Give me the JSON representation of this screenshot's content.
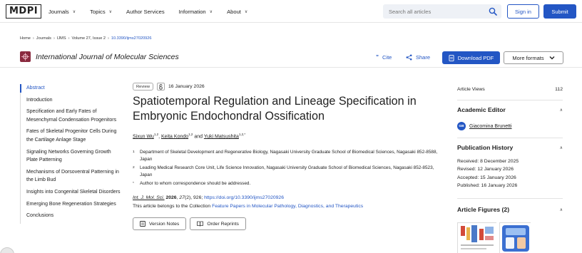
{
  "topnav": {
    "logo": "MDPI",
    "links": [
      {
        "label": "Journals",
        "dropdown": true
      },
      {
        "label": "Topics",
        "dropdown": true
      },
      {
        "label": "Author Services",
        "dropdown": false
      },
      {
        "label": "Information",
        "dropdown": true
      },
      {
        "label": "About",
        "dropdown": true
      }
    ],
    "search_placeholder": "Search all articles",
    "signin_label": "Sign in",
    "submit_label": "Submit"
  },
  "breadcrumb": {
    "items": [
      "Home",
      "Journals",
      "IJMS",
      "Volume 27, Issue 2"
    ],
    "doi": "10.3390/ijms27020926"
  },
  "journal_bar": {
    "title": "International Journal of Molecular Sciences",
    "cite_label": "Cite",
    "share_label": "Share",
    "download_label": "Download PDF",
    "more_formats_label": "More formats"
  },
  "toc": {
    "items": [
      {
        "label": "Abstract",
        "active": true
      },
      {
        "label": "Introduction",
        "active": false
      },
      {
        "label": "Specification and Early Fates of Mesenchymal Condensation Progenitors",
        "active": false
      },
      {
        "label": "Fates of Skeletal Progenitor Cells During the Cartilage Anlage Stage",
        "active": false
      },
      {
        "label": "Signaling Networks Governing Growth Plate Patterning",
        "active": false
      },
      {
        "label": "Mechanisms of Dorsoventral Patterning in the Limb Bud",
        "active": false
      },
      {
        "label": "Insights into Congenital Skeletal Disorders",
        "active": false
      },
      {
        "label": "Emerging Bone Regeneration Strategies",
        "active": false
      },
      {
        "label": "Conclusions",
        "active": false
      }
    ]
  },
  "article": {
    "type_badge": "Review",
    "date": "16 January 2026",
    "title": "Spatiotemporal Regulation and Lineage Specification in Embryonic Endochondral Ossification",
    "authors": [
      {
        "name": "Sixun Wu",
        "sup": "1,2"
      },
      {
        "name": "Keita Kondo",
        "sup": "1,2"
      },
      {
        "name": "Yuki Matsushita",
        "sup": "1,2,*"
      }
    ],
    "sep1": ", ",
    "sep2": " and ",
    "affiliations": [
      {
        "num": "1",
        "text": "Department of Skeletal Development and Regenerative Biology, Nagasaki University Graduate School of Biomedical Sciences, Nagasaki 852-8588, Japan"
      },
      {
        "num": "2",
        "text": "Leading Medical Research Core Unit, Life Science Innovation, Nagasaki University Graduate School of Biomedical Sciences, Nagasaki 852-8523, Japan"
      },
      {
        "num": "*",
        "text": "Author to whom correspondence should be addressed."
      }
    ],
    "citation": {
      "journal": "Int. J. Mol. Sci.",
      "year": "2026",
      "volume": "27",
      "rest": "(2), 926; ",
      "doi": "https://doi.org/10.3390/ijms27020926"
    },
    "collection_prefix": "This article belongs to the Collection ",
    "collection_link": "Feature Papers in Molecular Pathology, Diagnostics, and Therapeutics",
    "version_notes_label": "Version Notes",
    "order_reprints_label": "Order Reprints"
  },
  "sidebar": {
    "views_label": "Article Views",
    "views_count": "112",
    "editor_heading": "Academic Editor",
    "editor_initials": "GB",
    "editor_name": "Giacomina Brunetti",
    "history_heading": "Publication History",
    "history": [
      "Received: 8 December 2025",
      "Revised: 12 January 2026",
      "Accepted: 15 January 2026",
      "Published: 16 January 2026"
    ],
    "figures_heading": "Article Figures (2)"
  },
  "colors": {
    "accent": "#2356c4",
    "journal_logo": "#8a2a3f"
  }
}
